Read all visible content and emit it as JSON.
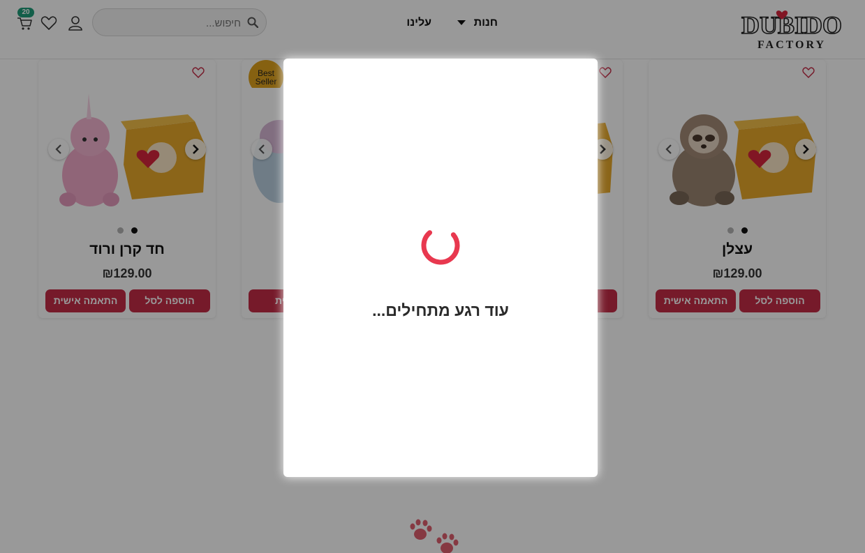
{
  "header": {
    "logo_word": "DUBIDO",
    "logo_sub": "FACTORY",
    "nav": [
      {
        "label": "חנות",
        "has_dropdown": true
      },
      {
        "label": "עלינו",
        "has_dropdown": false
      }
    ],
    "search": {
      "placeholder": "חיפוש..."
    },
    "cart_count": "20",
    "icons": [
      "user-icon",
      "heart-icon",
      "cart-icon",
      "search-icon"
    ]
  },
  "products": [
    {
      "title": "עצלן",
      "price": "₪129.00",
      "add_label": "הוספה לסל",
      "custom_label": "התאמה אישית",
      "badge": ""
    },
    {
      "title": "",
      "price": "",
      "add_label": "",
      "custom_label": "",
      "badge": ""
    },
    {
      "title": "",
      "price": "",
      "add_label": "",
      "custom_label": "אישית",
      "badge": "Best Seller"
    },
    {
      "title": "חד קרן ורוד",
      "price": "₪129.00",
      "add_label": "הוספה לסל",
      "custom_label": "התאמה אישית",
      "badge": ""
    }
  ],
  "modal": {
    "loading_text": "עוד רגע מתחילים..."
  },
  "colors": {
    "accent": "#c52c47",
    "badge_green": "#1f9d7a",
    "best_seller": "#e0a21d",
    "spinner": "#e8384f"
  }
}
